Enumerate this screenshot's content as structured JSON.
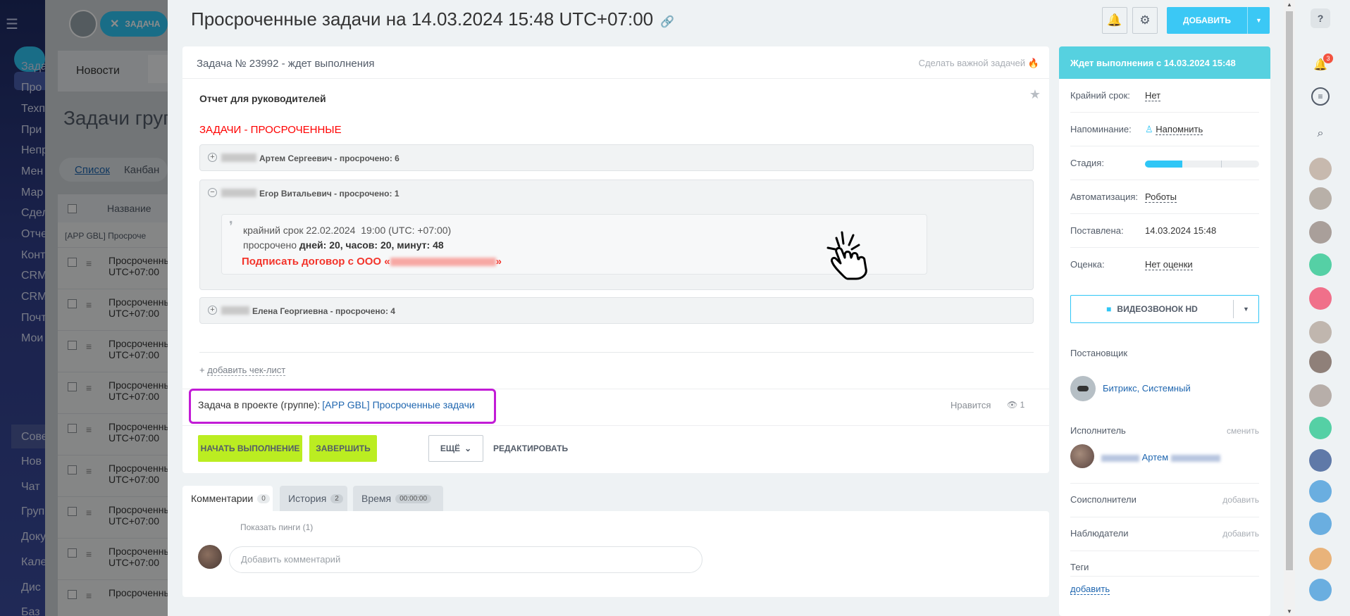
{
  "background": {
    "chip_label": "ЗАДАЧА",
    "tab_news": "Новости",
    "page_title": "Задачи груп",
    "view_list": "Список",
    "view_kanban": "Канбан",
    "col_name": "Название",
    "group_title": "[APP GBL] Просроче",
    "row_line1": "Просроченные",
    "row_line2": "UTC+07:00",
    "menu_items": [
      "Зада",
      "Про",
      "Техп",
      "При",
      "Непр",
      "Мен",
      "Мар",
      "Сдел",
      "Отче",
      "Конт",
      "CRM",
      "CRM",
      "Почт",
      "Мои",
      "Сове",
      "Нов",
      "Чат",
      "Груп",
      "Доку",
      "Кале",
      "Дис",
      "Баз"
    ]
  },
  "header": {
    "title": "Просроченные задачи на 14.03.2024 15:48 UTC+07:00",
    "add_label": "ДОБАВИТЬ"
  },
  "task": {
    "status_line": "Задача № 23992 - ждет выполнения",
    "make_important": "Сделать важной задачей",
    "report_title": "Отчет для руководителей",
    "section_title": "ЗАДАЧИ - ПРОСРОЧЕННЫЕ",
    "groups": [
      {
        "label": "Артем Сергеевич - просрочено: 6",
        "toggle": "+"
      },
      {
        "label": "Егор Витальевич - просрочено: 1",
        "toggle": "−"
      },
      {
        "label": "Елена Георгиевна - просрочено: 4",
        "toggle": "+"
      }
    ],
    "quote": {
      "deadline": "крайний срок 22.02.2024  19:00 (UTC: +07:00)",
      "overdue_prefix": "просрочено ",
      "overdue_value": "дней: 20, часов: 20, минут: 48",
      "task_prefix": "Подписать договор с ООО «",
      "task_suffix": "»"
    },
    "add_checklist": "добавить чек-лист",
    "project_prefix": "Задача в проекте (группе):",
    "project_link": "[APP GBL] Просроченные задачи",
    "likes": "Нравится",
    "views": "1",
    "btn_start": "НАЧАТЬ ВЫПОЛНЕНИЕ",
    "btn_finish": "ЗАВЕРШИТЬ",
    "btn_more": "ЕЩЁ",
    "btn_edit": "РЕДАКТИРОВАТЬ"
  },
  "tabs": [
    {
      "label": "Комментарии",
      "count": "0"
    },
    {
      "label": "История",
      "count": "2"
    },
    {
      "label": "Время",
      "count": "00:00:00"
    }
  ],
  "comments": {
    "show_pings": "Показать пинги (1)",
    "placeholder": "Добавить комментарий"
  },
  "sidebar": {
    "status": "Ждет выполнения с 14.03.2024 15:48",
    "deadline_label": "Крайний срок:",
    "deadline_value": "Нет",
    "reminder_label": "Напоминание:",
    "reminder_value": "Напомнить",
    "stage_label": "Стадия:",
    "stage_progress": 0.33,
    "automation_label": "Автоматизация:",
    "automation_value": "Роботы",
    "created_label": "Поставлена:",
    "created_value": "14.03.2024 15:48",
    "rating_label": "Оценка:",
    "rating_value": "Нет оценки",
    "video_call": "ВИДЕОЗВОНОК HD",
    "creator_label": "Постановщик",
    "creator_name": "Битрикс, Системный",
    "responsible_label": "Исполнитель",
    "responsible_change": "сменить",
    "responsible_name": "Артем",
    "accomplices_label": "Соисполнители",
    "accomplices_add": "добавить",
    "auditors_label": "Наблюдатели",
    "auditors_add": "добавить",
    "tags_label": "Теги",
    "tags_add": "добавить"
  },
  "right_bar": {
    "notifications_count": "3",
    "help_icon": "?"
  },
  "colors": {
    "accent": "#3bc8f5",
    "green_button": "#bbed21",
    "highlight_frame": "#c21bd6",
    "overdue_red": "#f3342b"
  }
}
